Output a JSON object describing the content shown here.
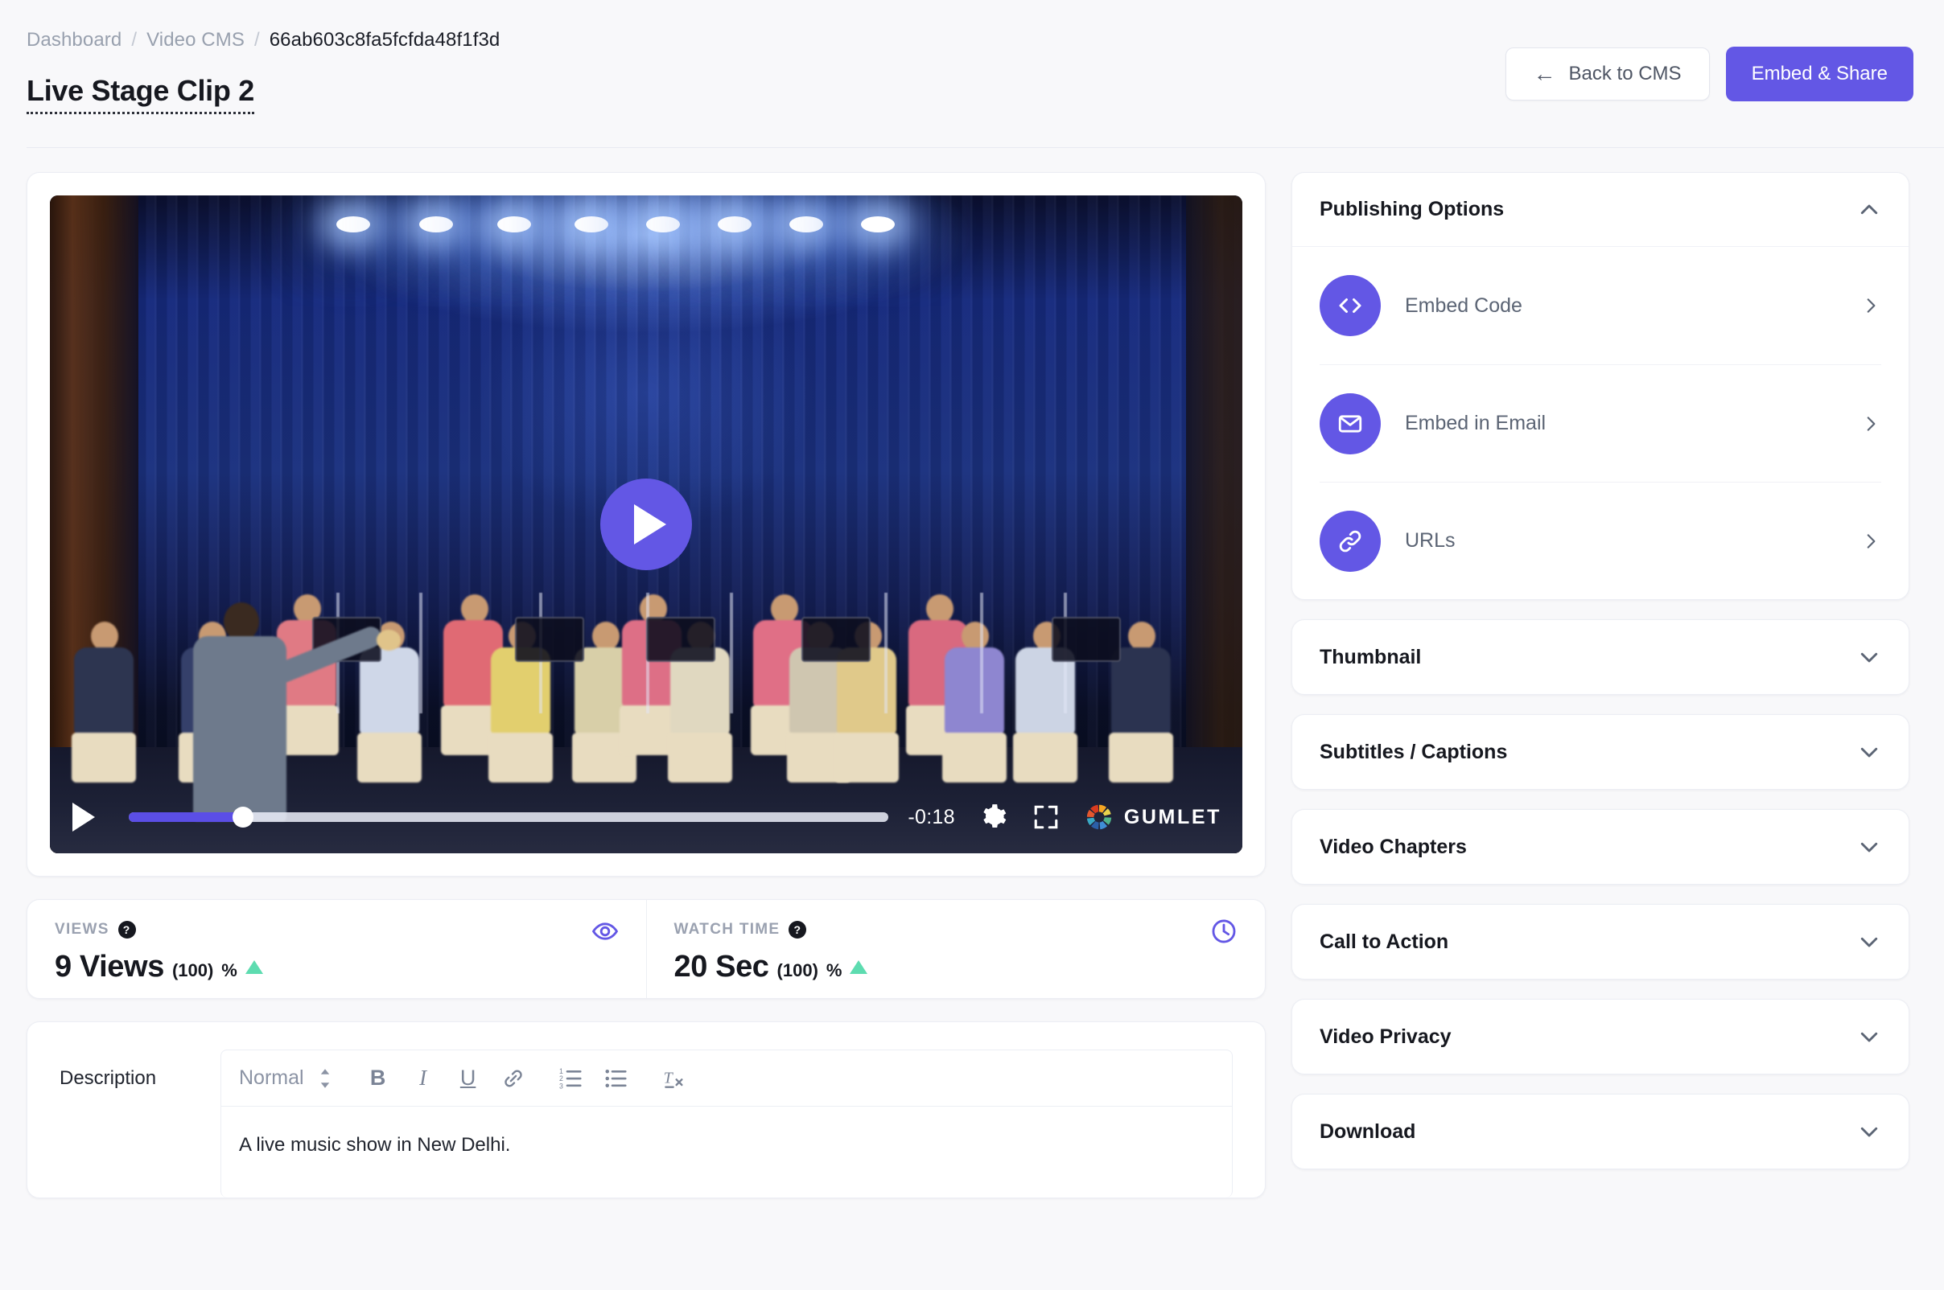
{
  "breadcrumb": {
    "items": [
      "Dashboard",
      "Video CMS",
      "66ab603c8fa5fcfda48f1f3d"
    ],
    "separator": "/"
  },
  "page_title": "Live Stage Clip 2",
  "header": {
    "back_button": "Back to CMS",
    "back_icon": "arrow-left-icon",
    "embed_button": "Embed & Share"
  },
  "colors": {
    "accent": "#6357e5",
    "page_bg": "#f8f8fa",
    "card_bg": "#ffffff",
    "border": "#eceef4",
    "text_dark": "#16181f",
    "text_muted": "#9aa1b0",
    "positive": "#5ddcb0"
  },
  "player": {
    "play_overlay_icon": "play-icon",
    "play_button_icon": "play-icon",
    "time_remaining": "-0:18",
    "progress_percent": 15,
    "settings_icon": "gear-icon",
    "fullscreen_icon": "fullscreen-icon",
    "brand": "GUMLET",
    "brand_icon": "gumlet-logo-icon"
  },
  "stats": [
    {
      "label": "VIEWS",
      "help_icon": "help-icon",
      "icon": "eye-icon",
      "value": "9 Views",
      "percent": "(100)",
      "percent_suffix": "%",
      "trend": "up"
    },
    {
      "label": "WATCH TIME",
      "help_icon": "help-icon",
      "icon": "clock-icon",
      "value": "20 Sec",
      "percent": "(100)",
      "percent_suffix": "%",
      "trend": "up"
    }
  ],
  "description": {
    "label": "Description",
    "toolbar": {
      "format_select": "Normal",
      "select_icon": "updown-chevron-icon",
      "bold": "B",
      "italic": "I",
      "underline": "U",
      "link_icon": "link-icon",
      "ordered_list_icon": "ordered-list-icon",
      "bullet_list_icon": "bullet-list-icon",
      "clear_format_icon": "clear-formatting-icon"
    },
    "body_text": "A live music show in New Delhi."
  },
  "sidebar": {
    "publishing": {
      "title": "Publishing Options",
      "chevron": "chevron-up-icon",
      "expanded": true,
      "items": [
        {
          "label": "Embed Code",
          "icon": "code-icon",
          "chevron": "chevron-right-icon"
        },
        {
          "label": "Embed in Email",
          "icon": "envelope-icon",
          "chevron": "chevron-right-icon"
        },
        {
          "label": "URLs",
          "icon": "link-icon",
          "chevron": "chevron-right-icon"
        }
      ]
    },
    "panels": [
      {
        "title": "Thumbnail",
        "chevron": "chevron-down-icon"
      },
      {
        "title": "Subtitles / Captions",
        "chevron": "chevron-down-icon"
      },
      {
        "title": "Video Chapters",
        "chevron": "chevron-down-icon"
      },
      {
        "title": "Call to Action",
        "chevron": "chevron-down-icon"
      },
      {
        "title": "Video Privacy",
        "chevron": "chevron-down-icon"
      },
      {
        "title": "Download",
        "chevron": "chevron-down-icon"
      }
    ]
  }
}
